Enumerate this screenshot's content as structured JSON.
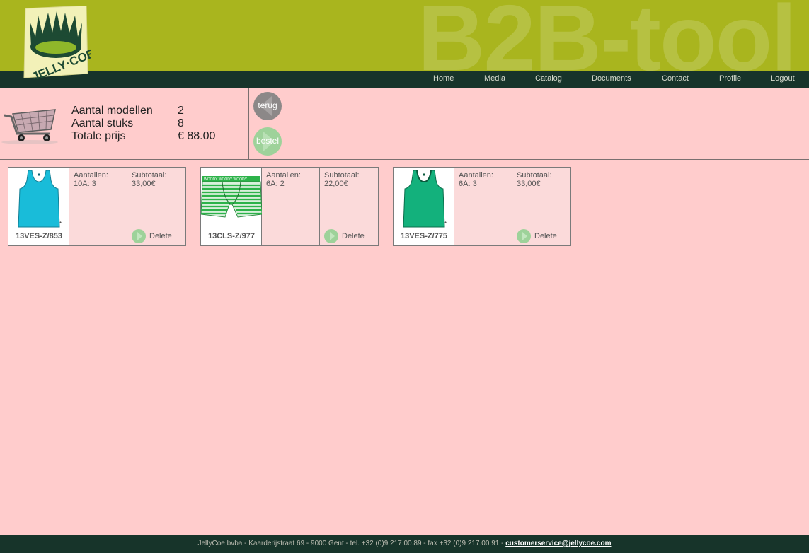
{
  "header": {
    "watermark": "B2B-tool",
    "logo_text": "JELLY COE"
  },
  "nav": {
    "items": [
      {
        "label": "Home"
      },
      {
        "label": "Media"
      },
      {
        "label": "Catalog"
      },
      {
        "label": "Documents"
      },
      {
        "label": "Contact"
      },
      {
        "label": "Profile"
      },
      {
        "label": "Logout"
      }
    ]
  },
  "summary": {
    "models_label": "Aantal modellen",
    "models_value": "2",
    "pieces_label": "Aantal stuks",
    "pieces_value": "8",
    "total_label": "Totale prijs",
    "total_value": "€ 88.00",
    "back_label": "terug",
    "order_label": "bestel"
  },
  "products": [
    {
      "code": "13VES-Z/853",
      "qty_label": "Aantallen:",
      "qty": "10A: 3",
      "sub_label": "Subtotaal:",
      "subtotal": "33,00€",
      "delete_label": "Delete",
      "color": "#19bcd9",
      "item": "tank-top"
    },
    {
      "code": "13CLS-Z/977",
      "qty_label": "Aantallen:",
      "qty": "6A: 2",
      "sub_label": "Subtotaal:",
      "subtotal": "22,00€",
      "delete_label": "Delete",
      "color": "#2db34a",
      "item": "boxer-shorts"
    },
    {
      "code": "13VES-Z/775",
      "qty_label": "Aantallen:",
      "qty": "6A: 3",
      "sub_label": "Subtotaal:",
      "subtotal": "33,00€",
      "delete_label": "Delete",
      "color": "#13b17c",
      "item": "tank-top"
    }
  ],
  "footer": {
    "text": "JellyCoe bvba - Kaarderijstraat 69 - 9000 Gent - tel. +32 (0)9 217.00.89 - fax +32 (0)9 217.00.91 - ",
    "email": "customerservice@jellycoe.com"
  },
  "colors": {
    "header_bg": "#a9b51e",
    "nav_bg": "#17342a",
    "page_bg": "#ffcccc",
    "card_bg": "#fbdada",
    "accent_green": "#9ed29a"
  }
}
